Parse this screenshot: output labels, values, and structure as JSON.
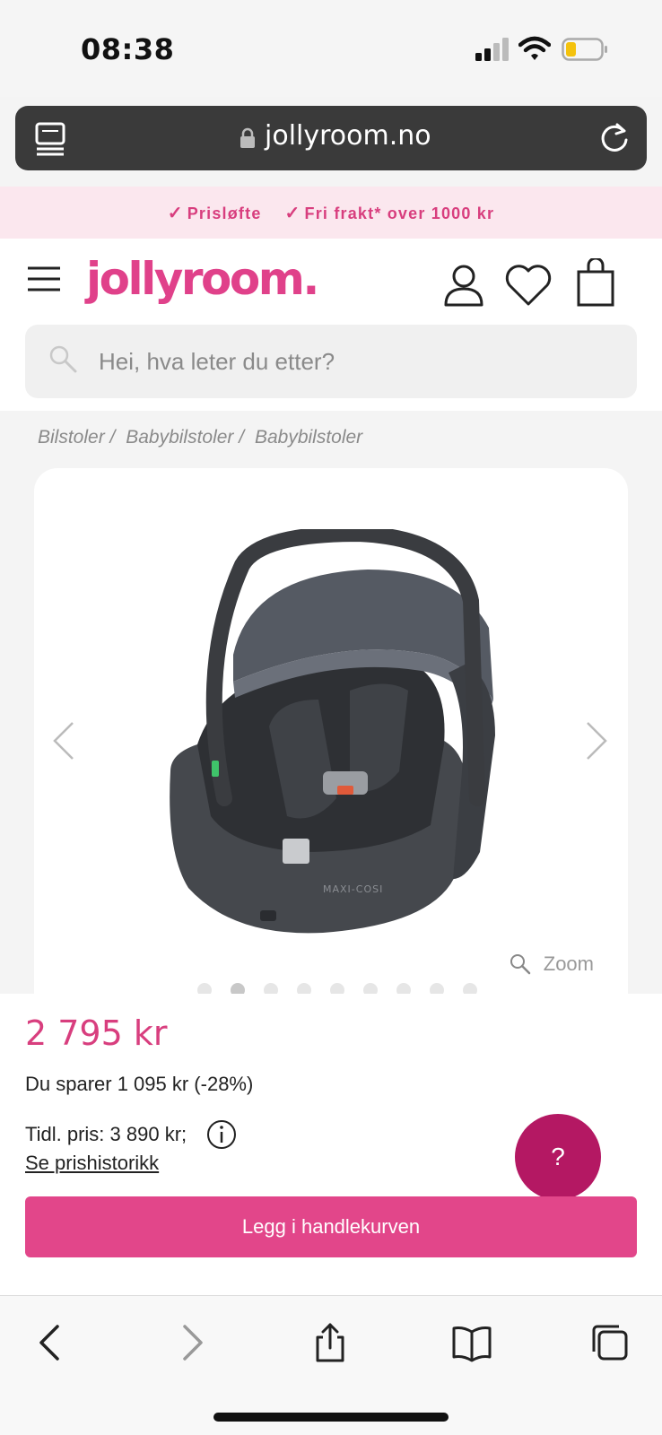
{
  "status_bar": {
    "time": "08:38"
  },
  "address_bar": {
    "url": "jollyroom.no"
  },
  "promo": {
    "items": [
      "Prisløfte",
      "Fri frakt* over 1000 kr"
    ],
    "check": "✓"
  },
  "header": {
    "logo": "jollyroom."
  },
  "search": {
    "placeholder": "Hei, hva leter du etter?"
  },
  "breadcrumb": {
    "items": [
      "Bilstoler /",
      "Babybilstoler /",
      "Babybilstoler"
    ]
  },
  "gallery": {
    "zoom_label": "Zoom",
    "image_count": 9,
    "active_index": 1,
    "product_brand_text": "MAXI-COSI"
  },
  "product": {
    "price": "2 795 kr",
    "saving": "Du sparer 1 095 kr (-28%)",
    "previous_price": "Tidl. pris: 3 890 kr;",
    "history_link": "Se prishistorikk",
    "add_to_cart": "Legg i handlekurven",
    "help_label": "?"
  },
  "colors": {
    "brand": "#e0418a",
    "cart_button": "#e2468a",
    "help_button": "#b41863",
    "promo_bg": "#fbe7ee"
  },
  "icons": {
    "menu": "hamburger-icon",
    "user": "user-icon",
    "wishlist": "heart-icon",
    "cart": "bag-icon",
    "search": "search-icon",
    "info": "info-icon",
    "safari": [
      "back-icon",
      "forward-icon",
      "share-icon",
      "bookmarks-icon",
      "tabs-icon"
    ]
  }
}
